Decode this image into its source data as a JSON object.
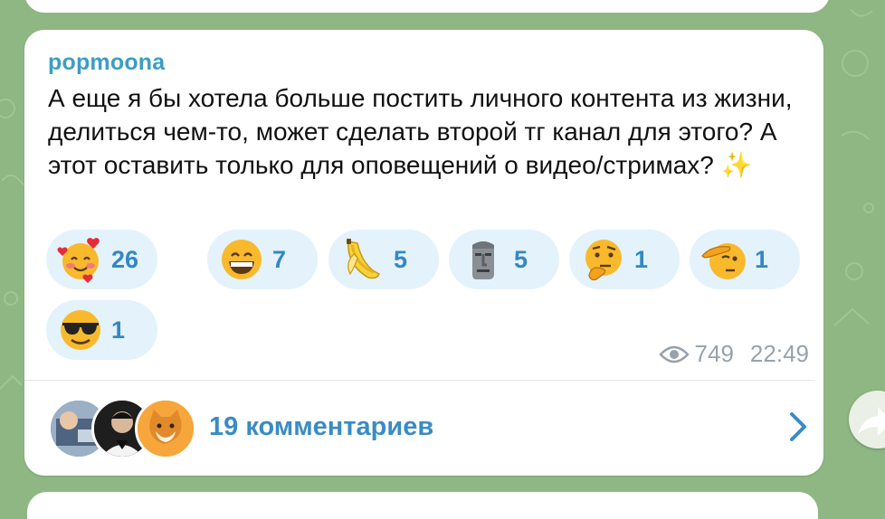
{
  "message": {
    "author": "popmoona",
    "text": "А еще я бы хотела больше постить личного контента из жизни, делиться чем-то, может сделать второй тг канал для этого? А этот оставить только для оповещений о видео/стримах? ✨"
  },
  "reactions": [
    {
      "icon": "smiling-face-with-hearts",
      "count": "26"
    },
    {
      "icon": "grinning-face",
      "count": "7"
    },
    {
      "icon": "banana",
      "count": "5"
    },
    {
      "icon": "moai",
      "count": "5"
    },
    {
      "icon": "thinking-face",
      "count": "1"
    },
    {
      "icon": "saluting-face",
      "count": "1"
    },
    {
      "icon": "sunglasses-face",
      "count": "1"
    }
  ],
  "meta": {
    "views": "749",
    "time": "22:49"
  },
  "comments": {
    "label": "19 комментариев"
  },
  "colors": {
    "background": "#8fb784",
    "author": "#3a9ec6",
    "reaction_bg": "#e4f2fb",
    "reaction_count": "#3288c2",
    "comments_link": "#3a8cc3"
  }
}
